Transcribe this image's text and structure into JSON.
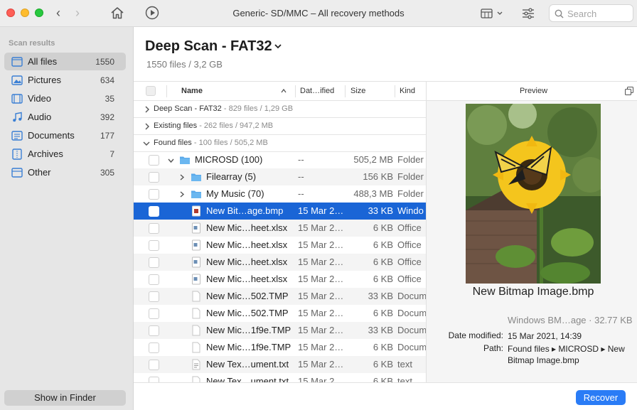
{
  "window": {
    "title": "Generic- SD/MMC – All recovery methods"
  },
  "search": {
    "placeholder": "Search"
  },
  "sidebar": {
    "header": "Scan results",
    "items": [
      {
        "label": "All files",
        "count": "1550",
        "icon": "all-files-icon"
      },
      {
        "label": "Pictures",
        "count": "634",
        "icon": "pictures-icon"
      },
      {
        "label": "Video",
        "count": "35",
        "icon": "video-icon"
      },
      {
        "label": "Audio",
        "count": "392",
        "icon": "audio-icon"
      },
      {
        "label": "Documents",
        "count": "177",
        "icon": "documents-icon"
      },
      {
        "label": "Archives",
        "count": "7",
        "icon": "archives-icon"
      },
      {
        "label": "Other",
        "count": "305",
        "icon": "other-icon"
      }
    ],
    "show_in_finder": "Show in Finder"
  },
  "scan": {
    "title": "Deep Scan - FAT32",
    "subtitle": "1550 files / 3,2 GB"
  },
  "table": {
    "columns": {
      "name": "Name",
      "date": "Dat…ified",
      "size": "Size",
      "kind": "Kind"
    },
    "groups": [
      {
        "label": "Deep Scan - FAT32",
        "meta": " - 829 files / 1,29 GB"
      },
      {
        "label": "Existing files",
        "meta": " - 262 files / 947,2 MB"
      },
      {
        "label": "Found files",
        "meta": " - 100 files / 505,2 MB"
      }
    ],
    "rows": [
      {
        "name": "MICROSD (100)",
        "date": "--",
        "size": "505,2 MB",
        "kind": "Folder"
      },
      {
        "name": "Filearray (5)",
        "date": "--",
        "size": "156 KB",
        "kind": "Folder"
      },
      {
        "name": "My Music (70)",
        "date": "--",
        "size": "488,3 MB",
        "kind": "Folder"
      },
      {
        "name": "New Bit…age.bmp",
        "date": "15 Mar 2…",
        "size": "33 KB",
        "kind": "Windo"
      },
      {
        "name": "New Mic…heet.xlsx",
        "date": "15 Mar 2…",
        "size": "6 KB",
        "kind": "Office"
      },
      {
        "name": "New Mic…heet.xlsx",
        "date": "15 Mar 2…",
        "size": "6 KB",
        "kind": "Office"
      },
      {
        "name": "New Mic…heet.xlsx",
        "date": "15 Mar 2…",
        "size": "6 KB",
        "kind": "Office"
      },
      {
        "name": "New Mic…heet.xlsx",
        "date": "15 Mar 2…",
        "size": "6 KB",
        "kind": "Office"
      },
      {
        "name": "New Mic…502.TMP",
        "date": "15 Mar 2…",
        "size": "33 KB",
        "kind": "Docum"
      },
      {
        "name": "New Mic…502.TMP",
        "date": "15 Mar 2…",
        "size": "6 KB",
        "kind": "Docum"
      },
      {
        "name": "New Mic…1f9e.TMP",
        "date": "15 Mar 2…",
        "size": "33 KB",
        "kind": "Docum"
      },
      {
        "name": "New Mic…1f9e.TMP",
        "date": "15 Mar 2…",
        "size": "6 KB",
        "kind": "Docum"
      },
      {
        "name": "New Tex…ument.txt",
        "date": "15 Mar 2…",
        "size": "6 KB",
        "kind": "text"
      },
      {
        "name": "New Tex…ument.txt",
        "date": "15 Mar 2…",
        "size": "6 KB",
        "kind": "text"
      }
    ]
  },
  "preview": {
    "title": "Preview",
    "file_name": "New Bitmap Image.bmp",
    "meta": "Windows BM…age · 32.77 KB",
    "date_label": "Date modified:",
    "date_value": "15 Mar 2021, 14:39",
    "path_label": "Path:",
    "path_value": "Found files ▸ MICROSD ▸ New Bitmap Image.bmp"
  },
  "actions": {
    "recover": "Recover"
  },
  "colors": {
    "accent": "#1a65d6",
    "button": "#2a7cf6",
    "folder": "#5aa9ea"
  }
}
